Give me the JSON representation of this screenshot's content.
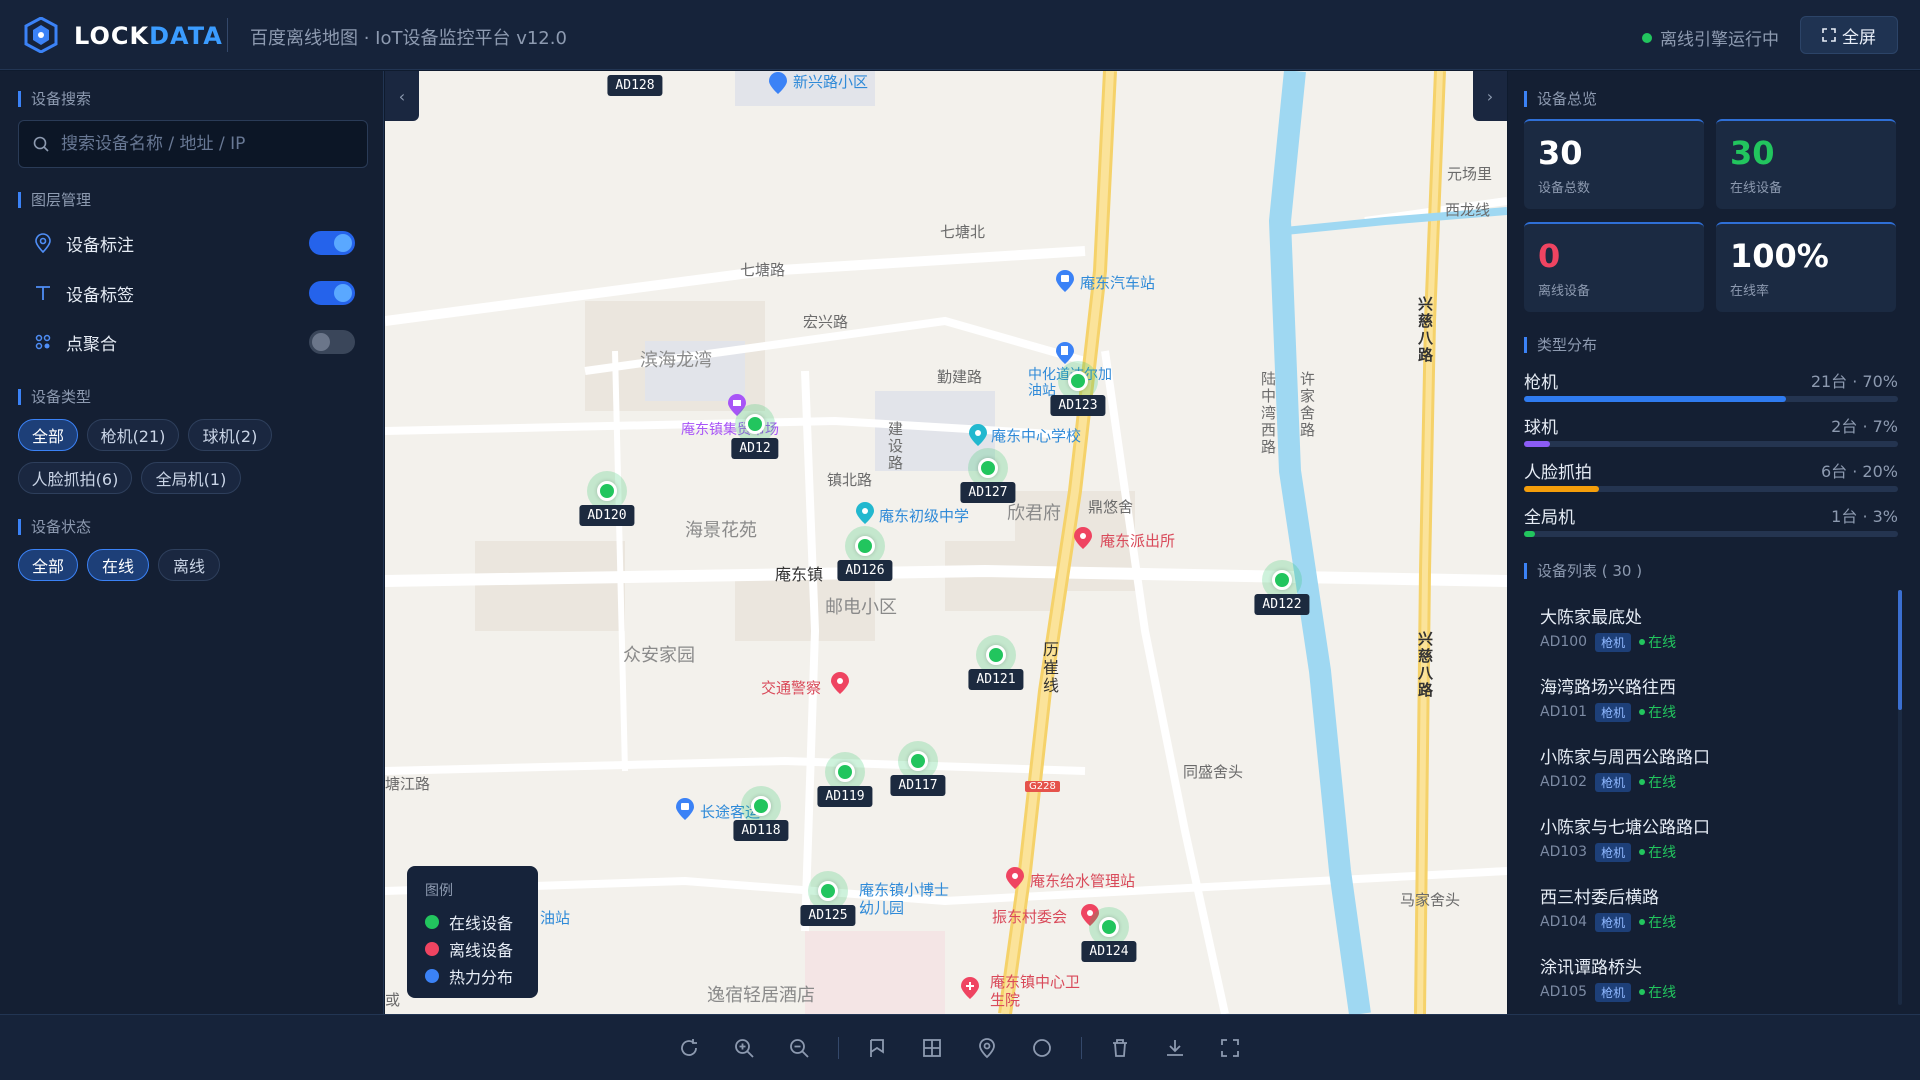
{
  "header": {
    "brand_a": "LOCK",
    "brand_b": "DATA",
    "title": "百度离线地图 · IoT设备监控平台 v12.0",
    "engine_status": "离线引擎运行中",
    "fullscreen_label": "全屏"
  },
  "left": {
    "search_title": "设备搜索",
    "search_placeholder": "搜索设备名称 / 地址 / IP",
    "layers_title": "图层管理",
    "layers": [
      {
        "label": "设备标注",
        "on": true
      },
      {
        "label": "设备标签",
        "on": true
      },
      {
        "label": "点聚合",
        "on": false
      }
    ],
    "type_title": "设备类型",
    "type_chips": [
      "全部",
      "枪机(21)",
      "球机(2)",
      "人脸抓拍(6)",
      "全局机(1)"
    ],
    "status_title": "设备状态",
    "status_chips": [
      "全部",
      "在线",
      "离线"
    ]
  },
  "map": {
    "places": [
      "七塘北",
      "七塘路",
      "宏兴路",
      "滨海龙湾",
      "勤建路",
      "建设路",
      "镇北路",
      "海景花苑",
      "欣君府",
      "鼎悠舍",
      "庵东镇",
      "邮电小区",
      "众安家园",
      "历崔线",
      "同盛舍头",
      "塘江路",
      "马家舍头",
      "逸宿轻居酒店",
      "元场里",
      "西龙线",
      "兴慈八路",
      "陆中湾西路",
      "许家舍路",
      "G228",
      "油站",
      "或"
    ],
    "pois": [
      "庵东汽车站",
      "中化道达尔加油站",
      "庵东中心学校",
      "庵东初级中学",
      "庵东派出所",
      "庵东镇集贸市场",
      "交通警察",
      "长途客运",
      "庵东镇小博士幼儿园",
      "庵东给水管理站",
      "振东村委会",
      "庵东镇中心卫生院",
      "新兴路小区"
    ],
    "devices": [
      "AD128",
      "AD12",
      "AD120",
      "AD123",
      "AD127",
      "AD126",
      "AD122",
      "AD121",
      "AD119",
      "AD117",
      "AD118",
      "AD125",
      "AD124"
    ]
  },
  "legend": {
    "title": "图例",
    "items": [
      {
        "label": "在线设备",
        "color": "#22c55e"
      },
      {
        "label": "离线设备",
        "color": "#ef4461"
      },
      {
        "label": "热力分布",
        "color": "#3b82f6"
      }
    ]
  },
  "right": {
    "overview_title": "设备总览",
    "stats": [
      {
        "value": "30",
        "label": "设备总数"
      },
      {
        "value": "30",
        "label": "在线设备"
      },
      {
        "value": "0",
        "label": "离线设备"
      },
      {
        "value": "100%",
        "label": "在线率"
      }
    ],
    "dist_title": "类型分布",
    "dist": [
      {
        "name": "枪机",
        "value": "21台 · 70%",
        "ratio": 0.7,
        "color": "#2f7bf0"
      },
      {
        "name": "球机",
        "value": "2台 · 7%",
        "ratio": 0.07,
        "color": "#8b5cf6"
      },
      {
        "name": "人脸抓拍",
        "value": "6台 · 20%",
        "ratio": 0.2,
        "color": "#f59e0b"
      },
      {
        "name": "全局机",
        "value": "1台 · 3%",
        "ratio": 0.03,
        "color": "#22c55e"
      }
    ],
    "list_title": "设备列表 ( 30 )",
    "list": [
      {
        "name": "大陈家最底处",
        "id": "AD100",
        "type": "枪机",
        "status": "在线"
      },
      {
        "name": "海湾路场兴路往西",
        "id": "AD101",
        "type": "枪机",
        "status": "在线"
      },
      {
        "name": "小陈家与周西公路路口",
        "id": "AD102",
        "type": "枪机",
        "status": "在线"
      },
      {
        "name": "小陈家与七塘公路路口",
        "id": "AD103",
        "type": "枪机",
        "status": "在线"
      },
      {
        "name": "西三村委后横路",
        "id": "AD104",
        "type": "枪机",
        "status": "在线"
      },
      {
        "name": "涂讯谭路桥头",
        "id": "AD105",
        "type": "枪机",
        "status": "在线"
      }
    ]
  },
  "toolbar": [
    "refresh-icon",
    "zoom-in-icon",
    "zoom-out-icon",
    "flag-icon",
    "grid-icon",
    "marker-icon",
    "circle-icon",
    "trash-icon",
    "download-icon",
    "expand-icon"
  ]
}
